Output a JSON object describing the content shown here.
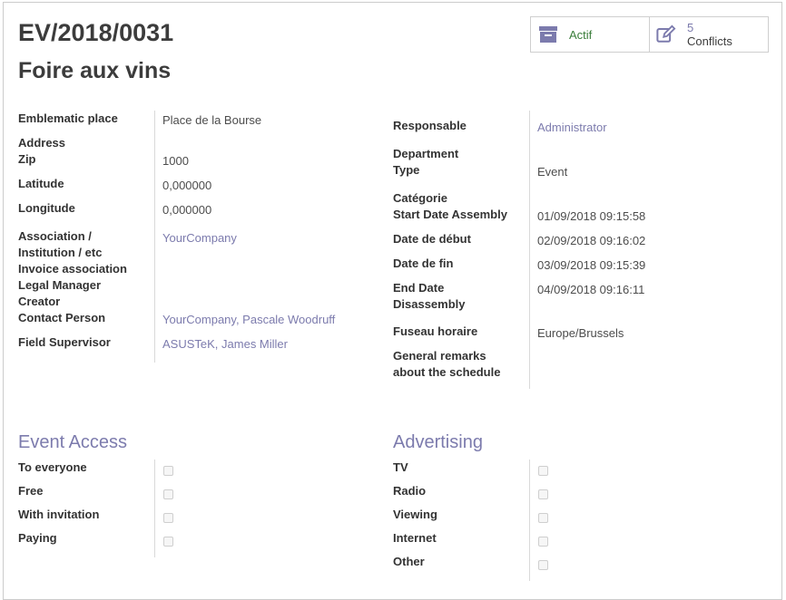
{
  "header": {
    "reference": "EV/2018/0031",
    "event_name": "Foire aux vins",
    "status_button": {
      "label": "Actif",
      "icon": "archive-icon"
    },
    "conflicts_button": {
      "count": "5",
      "label": "Conflicts",
      "icon": "edit-icon"
    }
  },
  "left_fields": {
    "emblematic_place": {
      "label": "Emblematic place",
      "value": "Place de la Bourse"
    },
    "address": {
      "label": "Address",
      "value": ""
    },
    "zip": {
      "label": "Zip",
      "value": "1000"
    },
    "latitude": {
      "label": "Latitude",
      "value": "0,000000"
    },
    "longitude": {
      "label": "Longitude",
      "value": "0,000000"
    },
    "association": {
      "label1": "Association /",
      "label2": "Institution / etc",
      "value": "YourCompany"
    },
    "invoice_association": {
      "label": "Invoice association",
      "value": ""
    },
    "legal_manager": {
      "label": "Legal Manager",
      "value": ""
    },
    "creator": {
      "label": "Creator",
      "value": ""
    },
    "contact_person": {
      "label": "Contact Person",
      "value": "YourCompany, Pascale Woodruff"
    },
    "field_supervisor": {
      "label": "Field Supervisor",
      "value": "ASUSTeK, James Miller"
    }
  },
  "right_fields": {
    "responsable": {
      "label": "Responsable",
      "value": "Administrator"
    },
    "department": {
      "label": "Department",
      "value": ""
    },
    "type": {
      "label": "Type",
      "value": "Event"
    },
    "categorie": {
      "label": "Catégorie",
      "value": ""
    },
    "start_date_assembly": {
      "label": "Start Date Assembly",
      "value": "01/09/2018 09:15:58"
    },
    "date_debut": {
      "label": "Date de début",
      "value": "02/09/2018 09:16:02"
    },
    "date_fin": {
      "label": "Date de fin",
      "value": "03/09/2018 09:15:39"
    },
    "end_date_disassembly": {
      "label1": "End Date",
      "label2": "Disassembly",
      "value": "04/09/2018 09:16:11"
    },
    "fuseau_horaire": {
      "label": "Fuseau horaire",
      "value": "Europe/Brussels"
    },
    "general_remarks": {
      "label1": "General remarks",
      "label2": "about the schedule",
      "value": ""
    }
  },
  "event_access": {
    "title": "Event Access",
    "items": [
      {
        "label": "To everyone",
        "checked": false
      },
      {
        "label": "Free",
        "checked": false
      },
      {
        "label": "With invitation",
        "checked": false
      },
      {
        "label": "Paying",
        "checked": false
      }
    ]
  },
  "advertising": {
    "title": "Advertising",
    "items": [
      {
        "label": "TV",
        "checked": false
      },
      {
        "label": "Radio",
        "checked": false
      },
      {
        "label": "Viewing",
        "checked": false
      },
      {
        "label": "Internet",
        "checked": false
      },
      {
        "label": "Other",
        "checked": false
      }
    ]
  },
  "colors": {
    "link": "#7c7bad",
    "active": "#3a7d3a",
    "icon": "#7c7bad"
  }
}
